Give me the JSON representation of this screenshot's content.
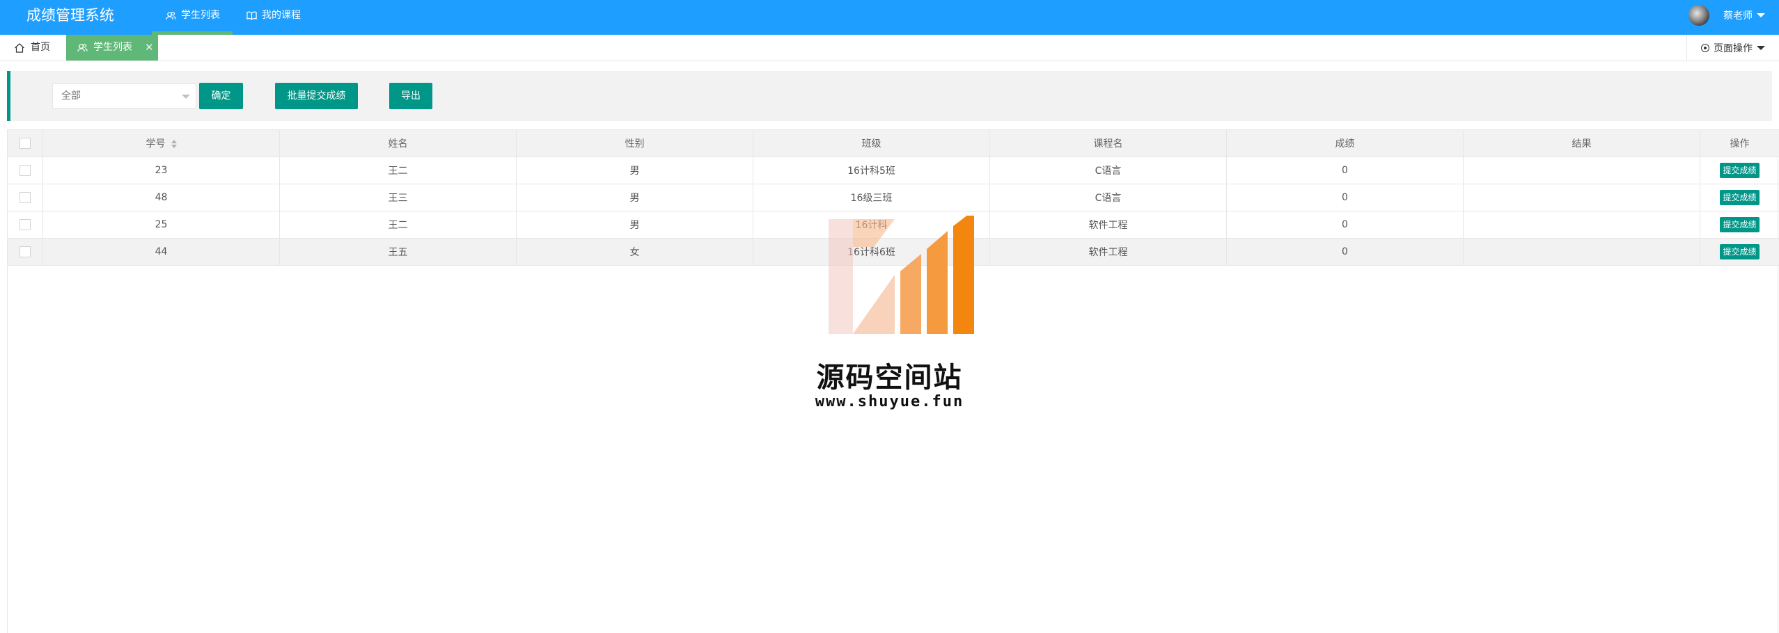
{
  "header": {
    "logo": "成绩管理系统",
    "nav": [
      {
        "label": "学生列表",
        "icon": "users-icon",
        "active": true
      },
      {
        "label": "我的课程",
        "icon": "book-icon",
        "active": false
      }
    ],
    "username": "蔡老师"
  },
  "tabs": {
    "home": "首页",
    "current": "学生列表",
    "page_ops": "页面操作"
  },
  "toolbar": {
    "select_value": "全部",
    "confirm": "确定",
    "batch_submit": "批量提交成绩",
    "export": "导出"
  },
  "table": {
    "headers": [
      "学号",
      "姓名",
      "性别",
      "班级",
      "课程名",
      "成绩",
      "结果",
      "操作"
    ],
    "rows": [
      {
        "id": "23",
        "name": "王二",
        "gender": "男",
        "class": "16计科5班",
        "course": "C语言",
        "score": "0",
        "result": "",
        "action": "提交成绩"
      },
      {
        "id": "48",
        "name": "王三",
        "gender": "男",
        "class": "16级三班",
        "course": "C语言",
        "score": "0",
        "result": "",
        "action": "提交成绩"
      },
      {
        "id": "25",
        "name": "王二",
        "gender": "男",
        "class": "16计科",
        "course": "软件工程",
        "score": "0",
        "result": "",
        "action": "提交成绩"
      },
      {
        "id": "44",
        "name": "王五",
        "gender": "女",
        "class": "16计科6班",
        "course": "软件工程",
        "score": "0",
        "result": "",
        "action": "提交成绩"
      }
    ]
  },
  "watermark": {
    "title": "源码空间站",
    "url": "www.shuyue.fun"
  },
  "colors": {
    "header_bg": "#1e9fff",
    "primary": "#009688",
    "active_tab": "#5fb878"
  }
}
